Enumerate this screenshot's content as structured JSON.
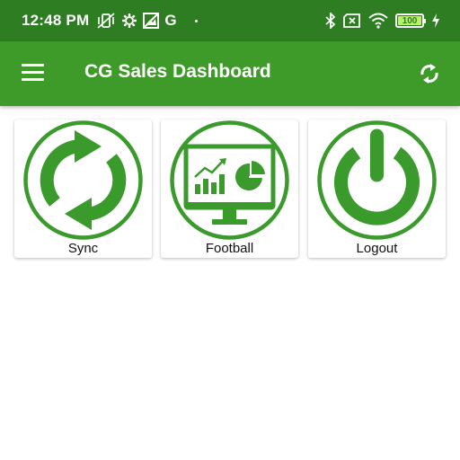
{
  "status_bar": {
    "time": "12:48 PM",
    "left_icons": [
      "vibrate-off-icon",
      "settings-icon",
      "image-off-icon",
      "google-icon"
    ],
    "google_letter": "G",
    "right_icons": [
      "bluetooth-icon",
      "sim-off-icon",
      "wifi-icon",
      "battery-icon",
      "charging-icon"
    ],
    "battery_level": "100"
  },
  "app_bar": {
    "title": "CG Sales Dashboard",
    "menu_icon": "hamburger-menu-icon",
    "action_icon": "sync-icon"
  },
  "tiles": [
    {
      "label": "Sync",
      "icon": "sync-icon"
    },
    {
      "label": "Football",
      "icon": "monitor-chart-icon"
    },
    {
      "label": "Logout",
      "icon": "power-icon"
    }
  ],
  "colors": {
    "status_bar": "#2e7d22",
    "app_bar": "#3e9b2a",
    "accent_green": "#3a9a2c",
    "background": "#ffffff"
  }
}
